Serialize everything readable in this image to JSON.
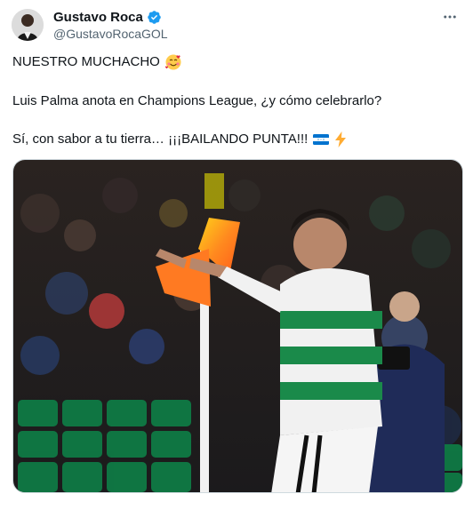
{
  "post": {
    "author": {
      "display_name": "Gustavo Roca",
      "handle": "@GustavoRocaGOL",
      "verified": true,
      "avatar_icon": "profile-photo"
    },
    "menu_icon": "more-horizontal-icon",
    "text": {
      "line1": "NUESTRO MUCHACHO",
      "line1_emoji": "smiling-face-with-hearts",
      "line2": "Luis Palma anota en Champions League, ¿y cómo celebrarlo?",
      "line3": "Sí, con sabor a tu tierra… ¡¡¡BAILANDO PUNTA!!!",
      "line3_emojis": [
        "flag-honduras",
        "high-voltage"
      ]
    },
    "media": {
      "kind": "photo",
      "description_icon": "football-celebration-photo"
    }
  },
  "colors": {
    "verified_blue": "#1d9bf0",
    "text_primary": "#0f1419",
    "text_secondary": "#536471",
    "border": "#cfd9de"
  }
}
